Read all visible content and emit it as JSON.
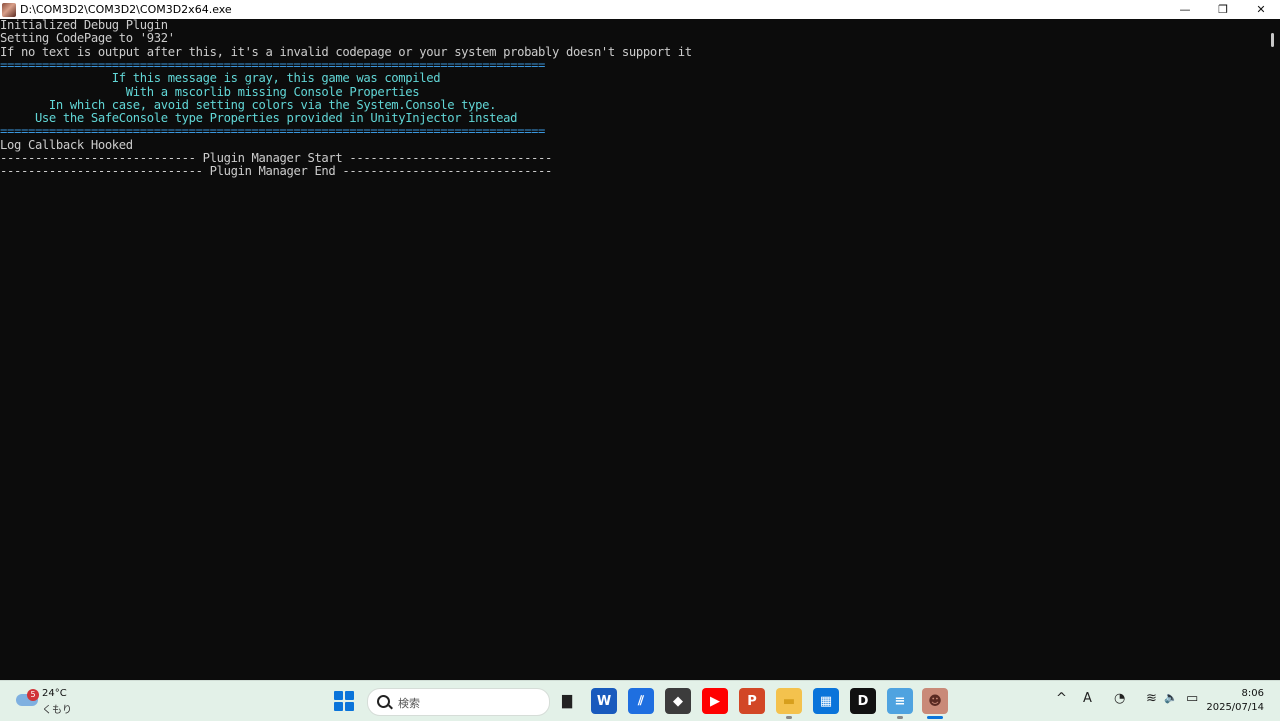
{
  "window": {
    "title": "D:\\COM3D2\\COM3D2\\COM3D2x64.exe",
    "minimize_glyph": "—",
    "restore_glyph": "❐",
    "close_glyph": "✕"
  },
  "console": {
    "lines": [
      {
        "text": "Initialized Debug Plugin",
        "color": "#cccccc"
      },
      {
        "text": "Setting CodePage to '932'",
        "color": "#cccccc"
      },
      {
        "text": "If no text is output after this, it's a invalid codepage or your system probably doesn't support it",
        "color": "#cccccc"
      },
      {
        "text": "==============================================================================",
        "color": "#3a96dd"
      },
      {
        "text": "                If this message is gray, this game was compiled",
        "color": "#61d6d6"
      },
      {
        "text": "                  With a mscorlib missing Console Properties",
        "color": "#61d6d6"
      },
      {
        "text": "       In which case, avoid setting colors via the System.Console type.",
        "color": "#61d6d6"
      },
      {
        "text": "     Use the SafeConsole type Properties provided in UnityInjector instead",
        "color": "#61d6d6"
      },
      {
        "text": "==============================================================================",
        "color": "#3a96dd"
      },
      {
        "text": "Log Callback Hooked",
        "color": "#cccccc"
      },
      {
        "text": "---------------------------- Plugin Manager Start -----------------------------",
        "color": "#cccccc"
      },
      {
        "text": "----------------------------- Plugin Manager End ------------------------------",
        "color": "#cccccc"
      }
    ]
  },
  "taskbar": {
    "weather": {
      "badge": "5",
      "temperature": "24°C",
      "condition": "くもり"
    },
    "search_placeholder": "検索",
    "apps": [
      {
        "name": "task-view-icon",
        "glyph": "▇",
        "bg": "transparent",
        "color": "#222222"
      },
      {
        "name": "word-icon",
        "glyph": "W",
        "bg": "#185abd",
        "color": "#ffffff"
      },
      {
        "name": "editor-icon",
        "glyph": "⫽",
        "bg": "#1f6fe0",
        "color": "#ffffff"
      },
      {
        "name": "unity-icon",
        "glyph": "◆",
        "bg": "#3c3c3c",
        "color": "#ffffff"
      },
      {
        "name": "youtube-icon",
        "glyph": "▶",
        "bg": "#ff0000",
        "color": "#ffffff"
      },
      {
        "name": "powerpoint-icon",
        "glyph": "P",
        "bg": "#d24726",
        "color": "#ffffff"
      },
      {
        "name": "file-explorer-icon",
        "glyph": "▬",
        "bg": "#f4c24d",
        "color": "#d79f1c"
      },
      {
        "name": "store-icon",
        "glyph": "▦",
        "bg": "#0a74da",
        "color": "#ffffff"
      },
      {
        "name": "dlsite-icon",
        "glyph": "D",
        "bg": "#111111",
        "color": "#ffffff"
      },
      {
        "name": "notepad-icon",
        "glyph": "≡",
        "bg": "#4fa3e0",
        "color": "#ffffff"
      },
      {
        "name": "com3d2-icon",
        "glyph": "☻",
        "bg": "#c98a78",
        "color": "#5a2a22"
      }
    ],
    "tray": {
      "chevron": "^",
      "ime": "A",
      "focus": "◔",
      "wifi": "≋",
      "volume": "🔈",
      "battery": "▭"
    },
    "time": "8:06",
    "date": "2025/07/14"
  }
}
